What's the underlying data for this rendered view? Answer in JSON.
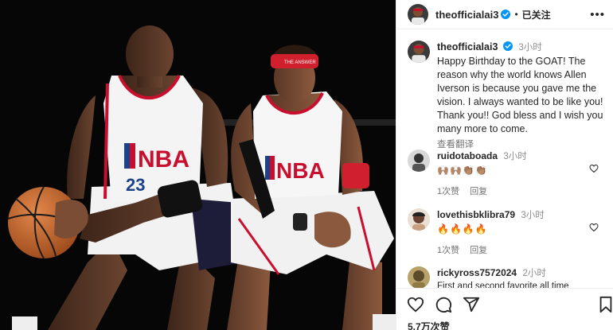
{
  "post": {
    "username": "theofficialai3",
    "follow_status": "已关注",
    "separator": "•",
    "more_icon": "more-horizontal-icon",
    "image_alt": "Two basketball players in NBA All-Star jerseys sitting side by side"
  },
  "photo": {
    "jersey_left": "NBA",
    "jersey_right": "NBA",
    "headband_text": "THE ANSWER"
  },
  "caption": {
    "username": "theofficialai3",
    "time": "3小时",
    "text": "Happy Birthday to the GOAT! The reason why the world knows Allen Iverson is because you gave me the vision. I always wanted to be like you! Thank you!! God bless and I wish you many more to come.",
    "translate_label": "查看翻译"
  },
  "comments": [
    {
      "username": "ruidotaboada",
      "time": "3小时",
      "text": "🙌🏽🙌🏽👏🏽👏🏽",
      "likes": "1次赞",
      "reply": "回复"
    },
    {
      "username": "lovethisbklibra79",
      "time": "3小时",
      "text": "🔥🔥🔥🔥",
      "likes": "1次赞",
      "reply": "回复"
    },
    {
      "username": "rickyross7572024",
      "time": "2小时",
      "text": "First and second favorite all time",
      "likes": "",
      "reply": ""
    }
  ],
  "actions": {
    "like_icon": "heart-icon",
    "comment_icon": "comment-icon",
    "share_icon": "share-icon",
    "save_icon": "bookmark-icon",
    "likes_count": "5.7万次赞"
  },
  "colors": {
    "verified": "#0095f6",
    "muted_text": "#737373",
    "border": "#efefef",
    "photo_bg": "#060606"
  }
}
